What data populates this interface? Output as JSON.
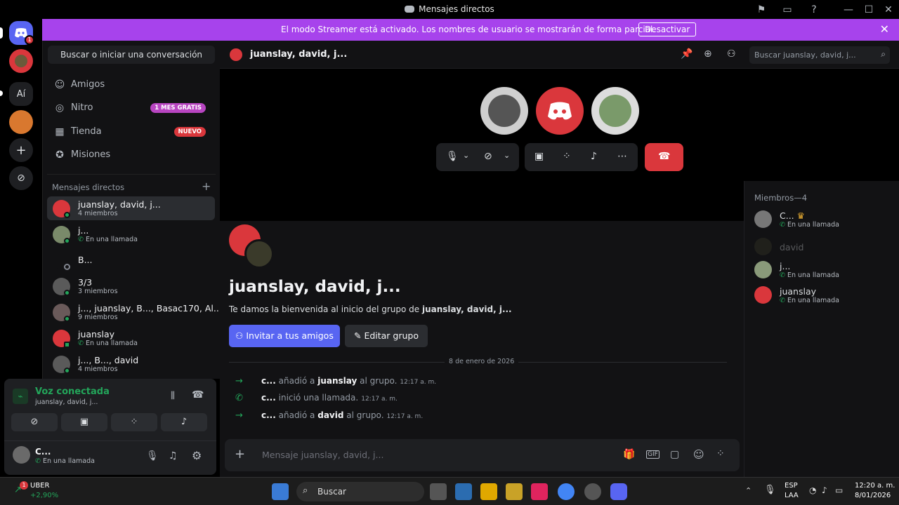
{
  "window": {
    "title": "Mensajes directos"
  },
  "banner": {
    "text": "El modo Streamer está activado. Los nombres de usuario se mostrarán de forma parcial.",
    "button": "Desactivar"
  },
  "servers": {
    "guild_label": "Aí",
    "mention_badge": "1"
  },
  "sidebar": {
    "search_placeholder": "Buscar o iniciar una conversación",
    "nav": [
      {
        "label": "Amigos",
        "icon": "friends-icon"
      },
      {
        "label": "Nitro",
        "icon": "nitro-icon",
        "badge": "1 MES GRATIS",
        "badge_color": "#b845c1"
      },
      {
        "label": "Tienda",
        "icon": "shop-icon",
        "badge": "NUEVO",
        "badge_color": "#da373c"
      },
      {
        "label": "Misiones",
        "icon": "quests-icon"
      }
    ],
    "dm_header": "Mensajes directos",
    "dms": [
      {
        "name": "juanslay, david, j...",
        "sub": "4 miembros"
      },
      {
        "name": "j...",
        "sub": "En una llamada"
      },
      {
        "name": "B...",
        "sub": ""
      },
      {
        "name": "3/3",
        "sub": "3 miembros"
      },
      {
        "name": "j..., juanslay, B..., Basac170, Al...",
        "sub": "9 miembros"
      },
      {
        "name": "juanslay",
        "sub": "En una llamada"
      },
      {
        "name": "j..., B..., david",
        "sub": "4 miembros"
      }
    ]
  },
  "voice": {
    "status": "Voz conectada",
    "channel": "juanslay, david, j..."
  },
  "user": {
    "name": "C...",
    "status": "En una llamada"
  },
  "channel": {
    "title": "juanslay, david, j...",
    "search_placeholder": "Buscar juanslay, david, j..."
  },
  "welcome": {
    "title": "juanslay, david, j...",
    "text_prefix": "Te damos la bienvenida al inicio del grupo de ",
    "text_group": "juanslay, david, j...",
    "invite_button": "Invitar a tus amigos",
    "edit_button": "Editar grupo"
  },
  "date_divider": "8 de enero de 2026",
  "messages": [
    {
      "actor": "c...",
      "action": "añadió a",
      "target": "juanslay",
      "suffix": "al grupo.",
      "time": "12:17 a. m."
    },
    {
      "actor": "c...",
      "action": "inició una llamada.",
      "target": "",
      "suffix": "",
      "time": "12:17 a. m."
    },
    {
      "actor": "c...",
      "action": "añadió a",
      "target": "david",
      "suffix": "al grupo.",
      "time": "12:17 a. m."
    }
  ],
  "composer": {
    "placeholder": "Mensaje juanslay, david, j..."
  },
  "members": {
    "header": "Miembros—4",
    "list": [
      {
        "name": "C...",
        "sub": "En una llamada"
      },
      {
        "name": "david",
        "sub": ""
      },
      {
        "name": "j...",
        "sub": "En una llamada"
      },
      {
        "name": "juanslay",
        "sub": "En una llamada"
      }
    ]
  },
  "taskbar": {
    "stock_name": "UBER",
    "stock_change": "+2,90%",
    "search": "Buscar",
    "lang1": "ESP",
    "lang2": "LAA",
    "time": "12:20 a. m.",
    "date": "8/01/2026",
    "notif": "1"
  },
  "colors": {
    "accent": "#5865f2",
    "streamer": "#a743ec",
    "danger": "#da373c",
    "green": "#23a55a"
  }
}
